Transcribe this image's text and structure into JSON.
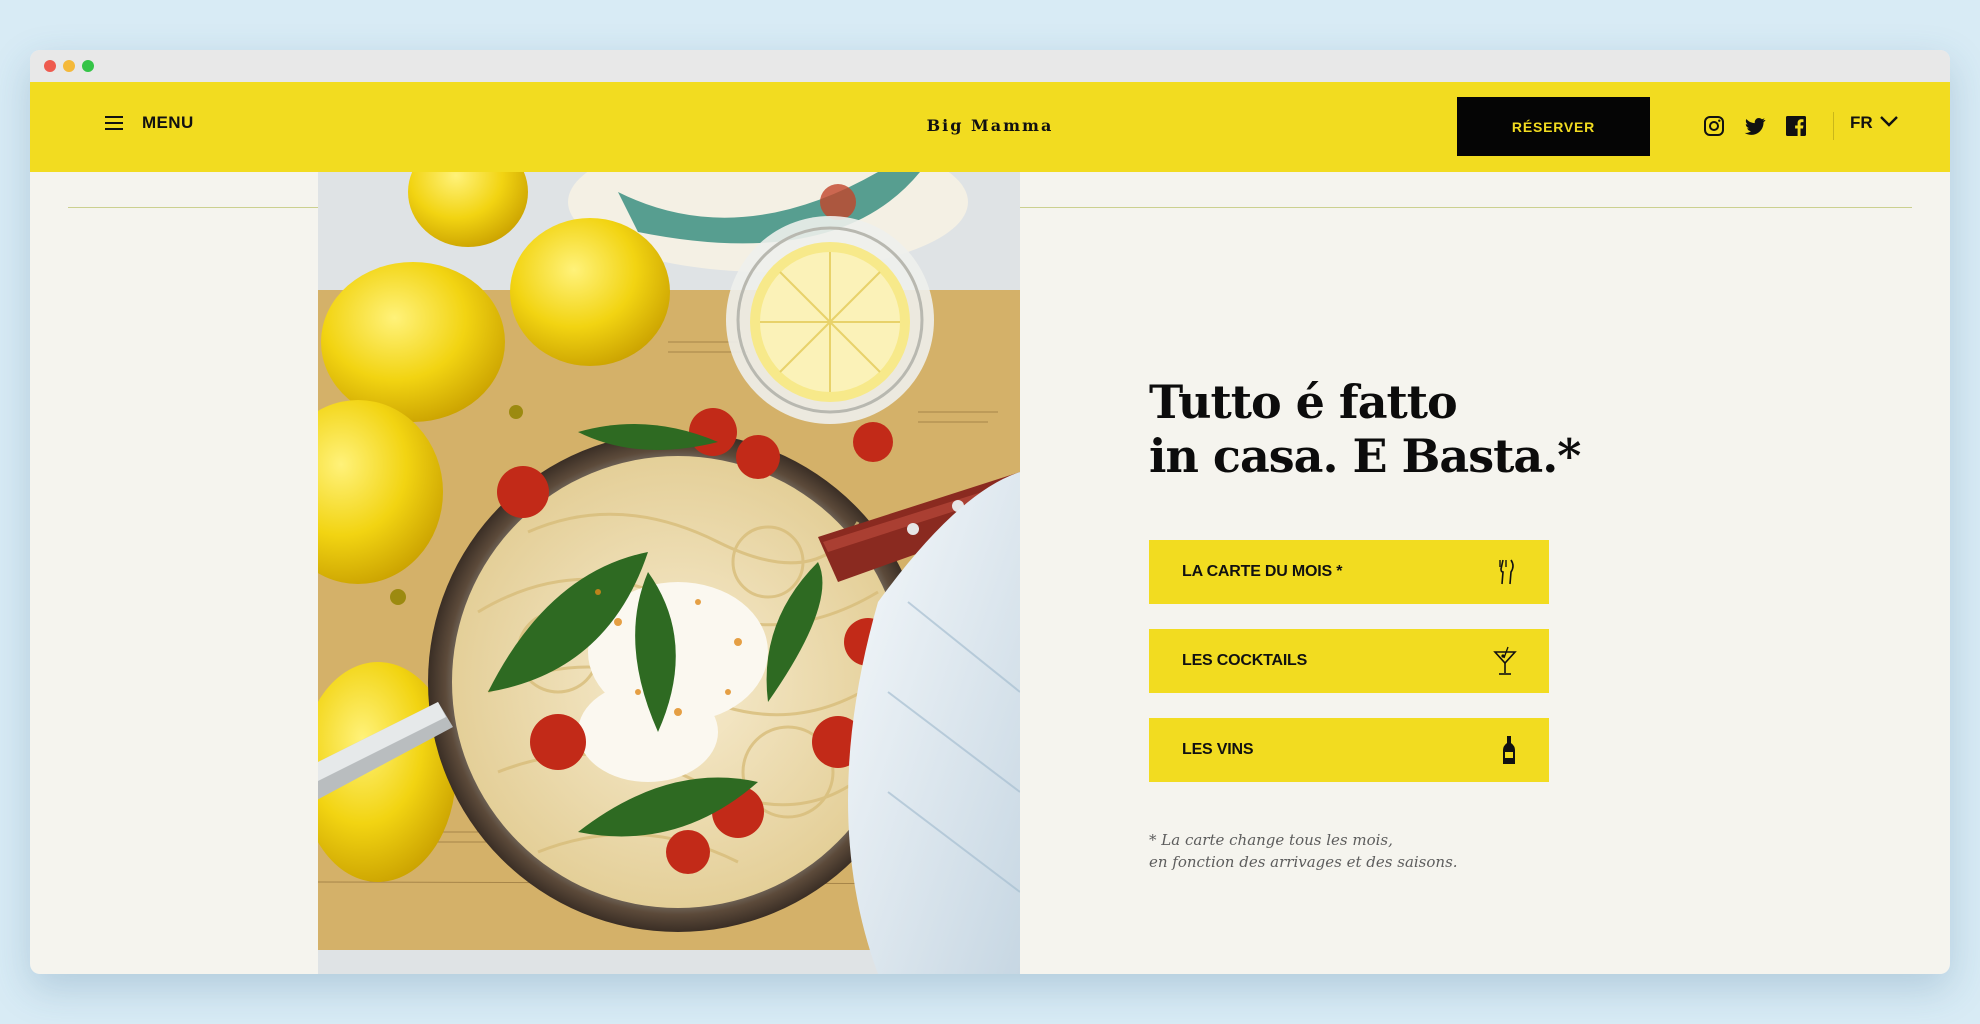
{
  "header": {
    "menu_label": "MENU",
    "logo_text": "Big Mamma",
    "reserve_label": "RÉSERVER",
    "language": "FR",
    "icons": {
      "menu": "hamburger-icon",
      "instagram": "instagram-icon",
      "twitter": "twitter-icon",
      "facebook": "facebook-icon",
      "language_dropdown": "chevron-down-icon"
    }
  },
  "hero": {
    "image": "pasta-with-lemons-photo",
    "headline_line1": "Tutto é fatto",
    "headline_line2": "in casa. E Basta.*"
  },
  "menu_links": [
    {
      "label": "LA CARTE DU MOIS *",
      "icon": "cutlery-icon"
    },
    {
      "label": "LES COCKTAILS",
      "icon": "cocktail-icon"
    },
    {
      "label": "LES VINS",
      "icon": "wine-bottle-icon"
    }
  ],
  "footnote": {
    "line1": "* La carte change tous les mois,",
    "line2": "en fonction des arrivages et des saisons."
  },
  "colors": {
    "brand_yellow": "#f2dc20",
    "background": "#f5f4ee",
    "button_black": "#050505",
    "text_dark": "#111111"
  }
}
